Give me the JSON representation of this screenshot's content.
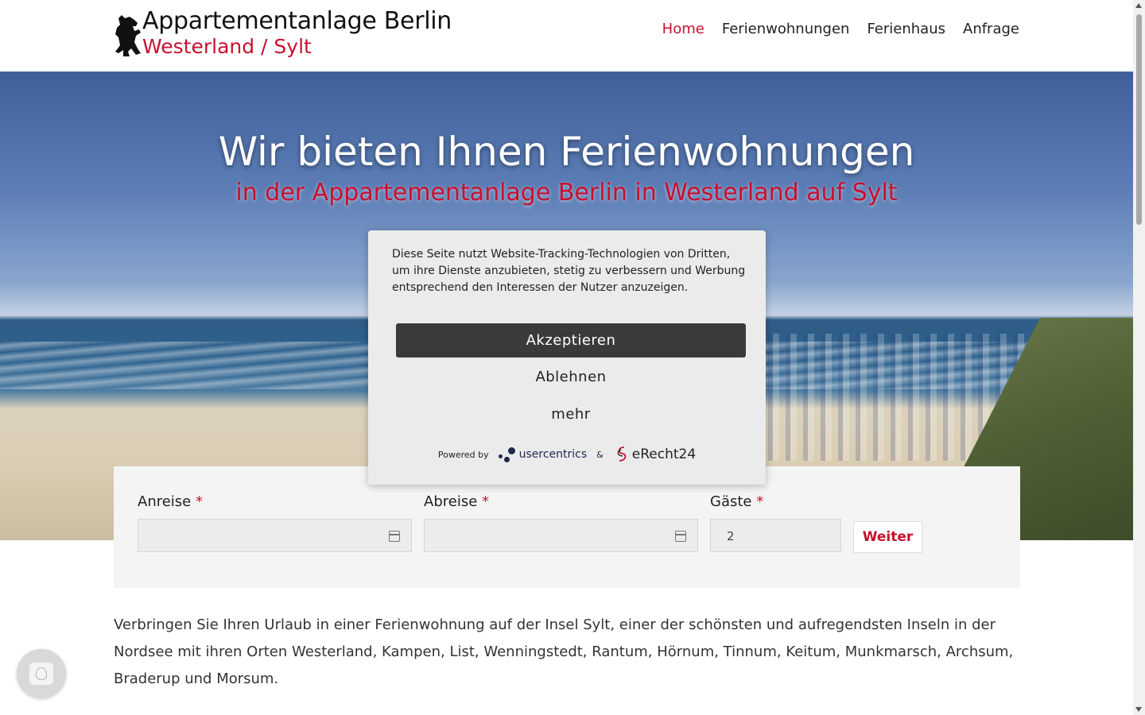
{
  "header": {
    "logo_line1": "Appartementanlage Berlin",
    "logo_line2": "Westerland / Sylt",
    "nav": [
      {
        "label": "Home",
        "active": true
      },
      {
        "label": "Ferienwohnungen",
        "active": false
      },
      {
        "label": "Ferienhaus",
        "active": false
      },
      {
        "label": "Anfrage",
        "active": false
      }
    ]
  },
  "hero": {
    "title": "Wir bieten Ihnen Ferienwohnungen",
    "subtitle": "in der Appartementanlage Berlin in Westerland auf Sylt"
  },
  "booking": {
    "arrival_label": "Anreise",
    "departure_label": "Abreise",
    "guests_label": "Gäste",
    "required_mark": "*",
    "arrival_value": "",
    "departure_value": "",
    "guests_value": "2",
    "submit_label": "Weiter"
  },
  "intro": {
    "text": "Verbringen Sie Ihren Urlaub in einer Ferienwohnung auf der Insel Sylt, einer der schönsten und aufregendsten Inseln in der Nordsee mit ihren Orten Westerland, Kampen, List, Wenningstedt, Rantum, Hörnum, Tinnum, Keitum, Munkmarsch, Archsum, Braderup und Morsum."
  },
  "cookie": {
    "text": "Diese Seite nutzt Website-Tracking-Technologien von Dritten, um ihre Dienste anzubieten, stetig zu verbessern und Werbung entsprechend den Interessen der Nutzer anzuzeigen.",
    "accept_label": "Akzeptieren",
    "deny_label": "Ablehnen",
    "more_label": "mehr",
    "powered_by": "Powered by",
    "brand1": "usercentrics",
    "amp": "&",
    "brand2": "eRecht24"
  },
  "colors": {
    "accent": "#c8102e",
    "dialog_button": "#3a3a3a"
  }
}
